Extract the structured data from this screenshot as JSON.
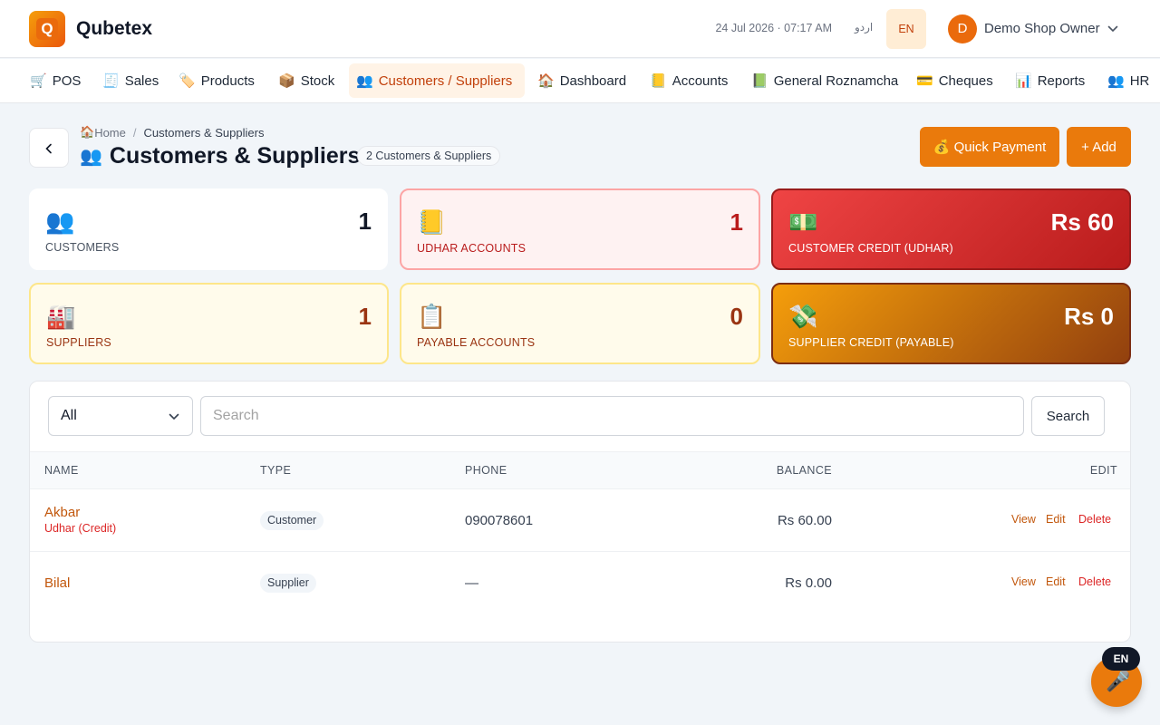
{
  "app": {
    "brand_letter": "Q",
    "brand_name": "Qubetex",
    "datetime": "24 Jul 2026 · 07:17 AM",
    "lang_urdu": "اردو",
    "lang_en": "EN",
    "user_initial": "D",
    "user_name": "Demo Shop Owner",
    "accent_color": "#ea7a0c"
  },
  "nav": [
    {
      "icon": "🛒",
      "label": "POS"
    },
    {
      "icon": "🧾",
      "label": "Sales"
    },
    {
      "icon": "🏷️",
      "label": "Products"
    },
    {
      "icon": "📦",
      "label": "Stock"
    },
    {
      "icon": "👥",
      "label": "Customers / Suppliers",
      "active": true
    },
    {
      "icon": "🏠",
      "label": "Dashboard"
    },
    {
      "icon": "📒",
      "label": "Accounts"
    },
    {
      "icon": "📗",
      "label": "General Roznamcha"
    },
    {
      "icon": "💳",
      "label": "Cheques"
    },
    {
      "icon": "📊",
      "label": "Reports"
    },
    {
      "icon": "👥",
      "label": "HR"
    }
  ],
  "header": {
    "breadcrumb_home_icon": "🏠",
    "breadcrumb_home": "Home",
    "breadcrumb_sep": "/",
    "breadcrumb_current": "Customers & Suppliers",
    "title_icon": "👥",
    "title": "Customers & Suppliers",
    "count_badge": "2 Customers & Suppliers",
    "quick_payment_label": "💰 Quick Payment",
    "add_label": "+ Add"
  },
  "stats": {
    "customers": {
      "icon": "👥",
      "value": "1",
      "label": "Customers"
    },
    "udhar_accounts": {
      "icon": "📒",
      "value": "1",
      "label": "Udhar Accounts"
    },
    "customer_credit": {
      "icon": "💵",
      "value": "Rs 60",
      "label": "Customer Credit (Udhar)"
    },
    "suppliers": {
      "icon": "🏭",
      "value": "1",
      "label": "Suppliers"
    },
    "payable_accounts": {
      "icon": "📋",
      "value": "0",
      "label": "Payable Accounts"
    },
    "supplier_credit": {
      "icon": "💸",
      "value": "Rs 0",
      "label": "Supplier Credit (Payable)"
    }
  },
  "filters": {
    "type_selected": "All",
    "search_placeholder": "Search",
    "search_button": "Search"
  },
  "table": {
    "columns": {
      "name": "NAME",
      "type": "TYPE",
      "phone": "PHONE",
      "balance": "BALANCE",
      "edit": "EDIT"
    },
    "rows": [
      {
        "name": "Akbar",
        "sub": "Udhar (Credit)",
        "type": "Customer",
        "phone": "090078601",
        "balance": "Rs 60.00",
        "view": "View",
        "edit": "Edit",
        "delete": "Delete"
      },
      {
        "name": "Bilal",
        "sub": "",
        "type": "Supplier",
        "phone": "—",
        "balance": "Rs 0.00",
        "view": "View",
        "edit": "Edit",
        "delete": "Delete"
      }
    ]
  },
  "voice": {
    "badge": "EN",
    "icon": "🎤"
  }
}
